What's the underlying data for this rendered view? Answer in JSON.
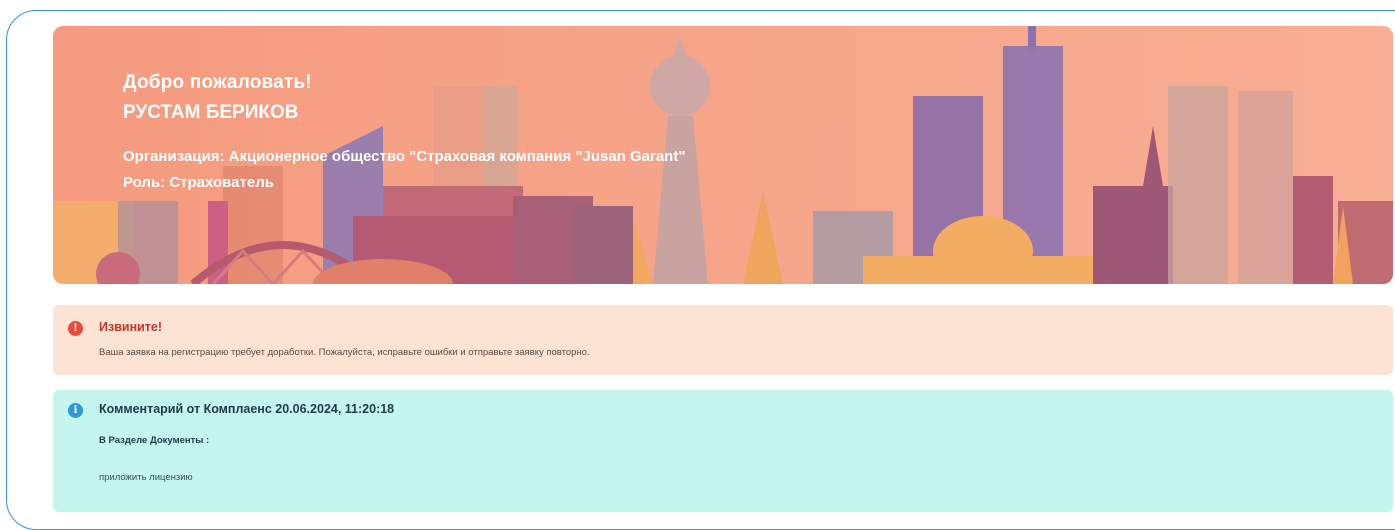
{
  "banner": {
    "welcome": "Добро пожаловать!",
    "user_name": "РУСТАМ БЕРИКОВ",
    "organization": "Организация: Акционерное общество \"Страховая компания \"Jusan Garant\"",
    "role": "Роль: Страхователь",
    "background_color": "#f6a489"
  },
  "error_alert": {
    "icon": "exclamation-circle-icon",
    "title": "Извините!",
    "message": "Ваша заявка на регистрацию требует доработки. Пожалуйста, исправьте ошибки и отправьте заявку повторно.",
    "background_color": "#fde3d3",
    "accent_color": "#e84c3d"
  },
  "comment_card": {
    "icon": "info-circle-icon",
    "title": "Комментарий от Комплаенс 20.06.2024, 11:20:18",
    "section": "В Разделе Документы :",
    "comment": "приложить лицензию",
    "background_color": "#c5f5ef",
    "accent_color": "#2c9ad8"
  }
}
